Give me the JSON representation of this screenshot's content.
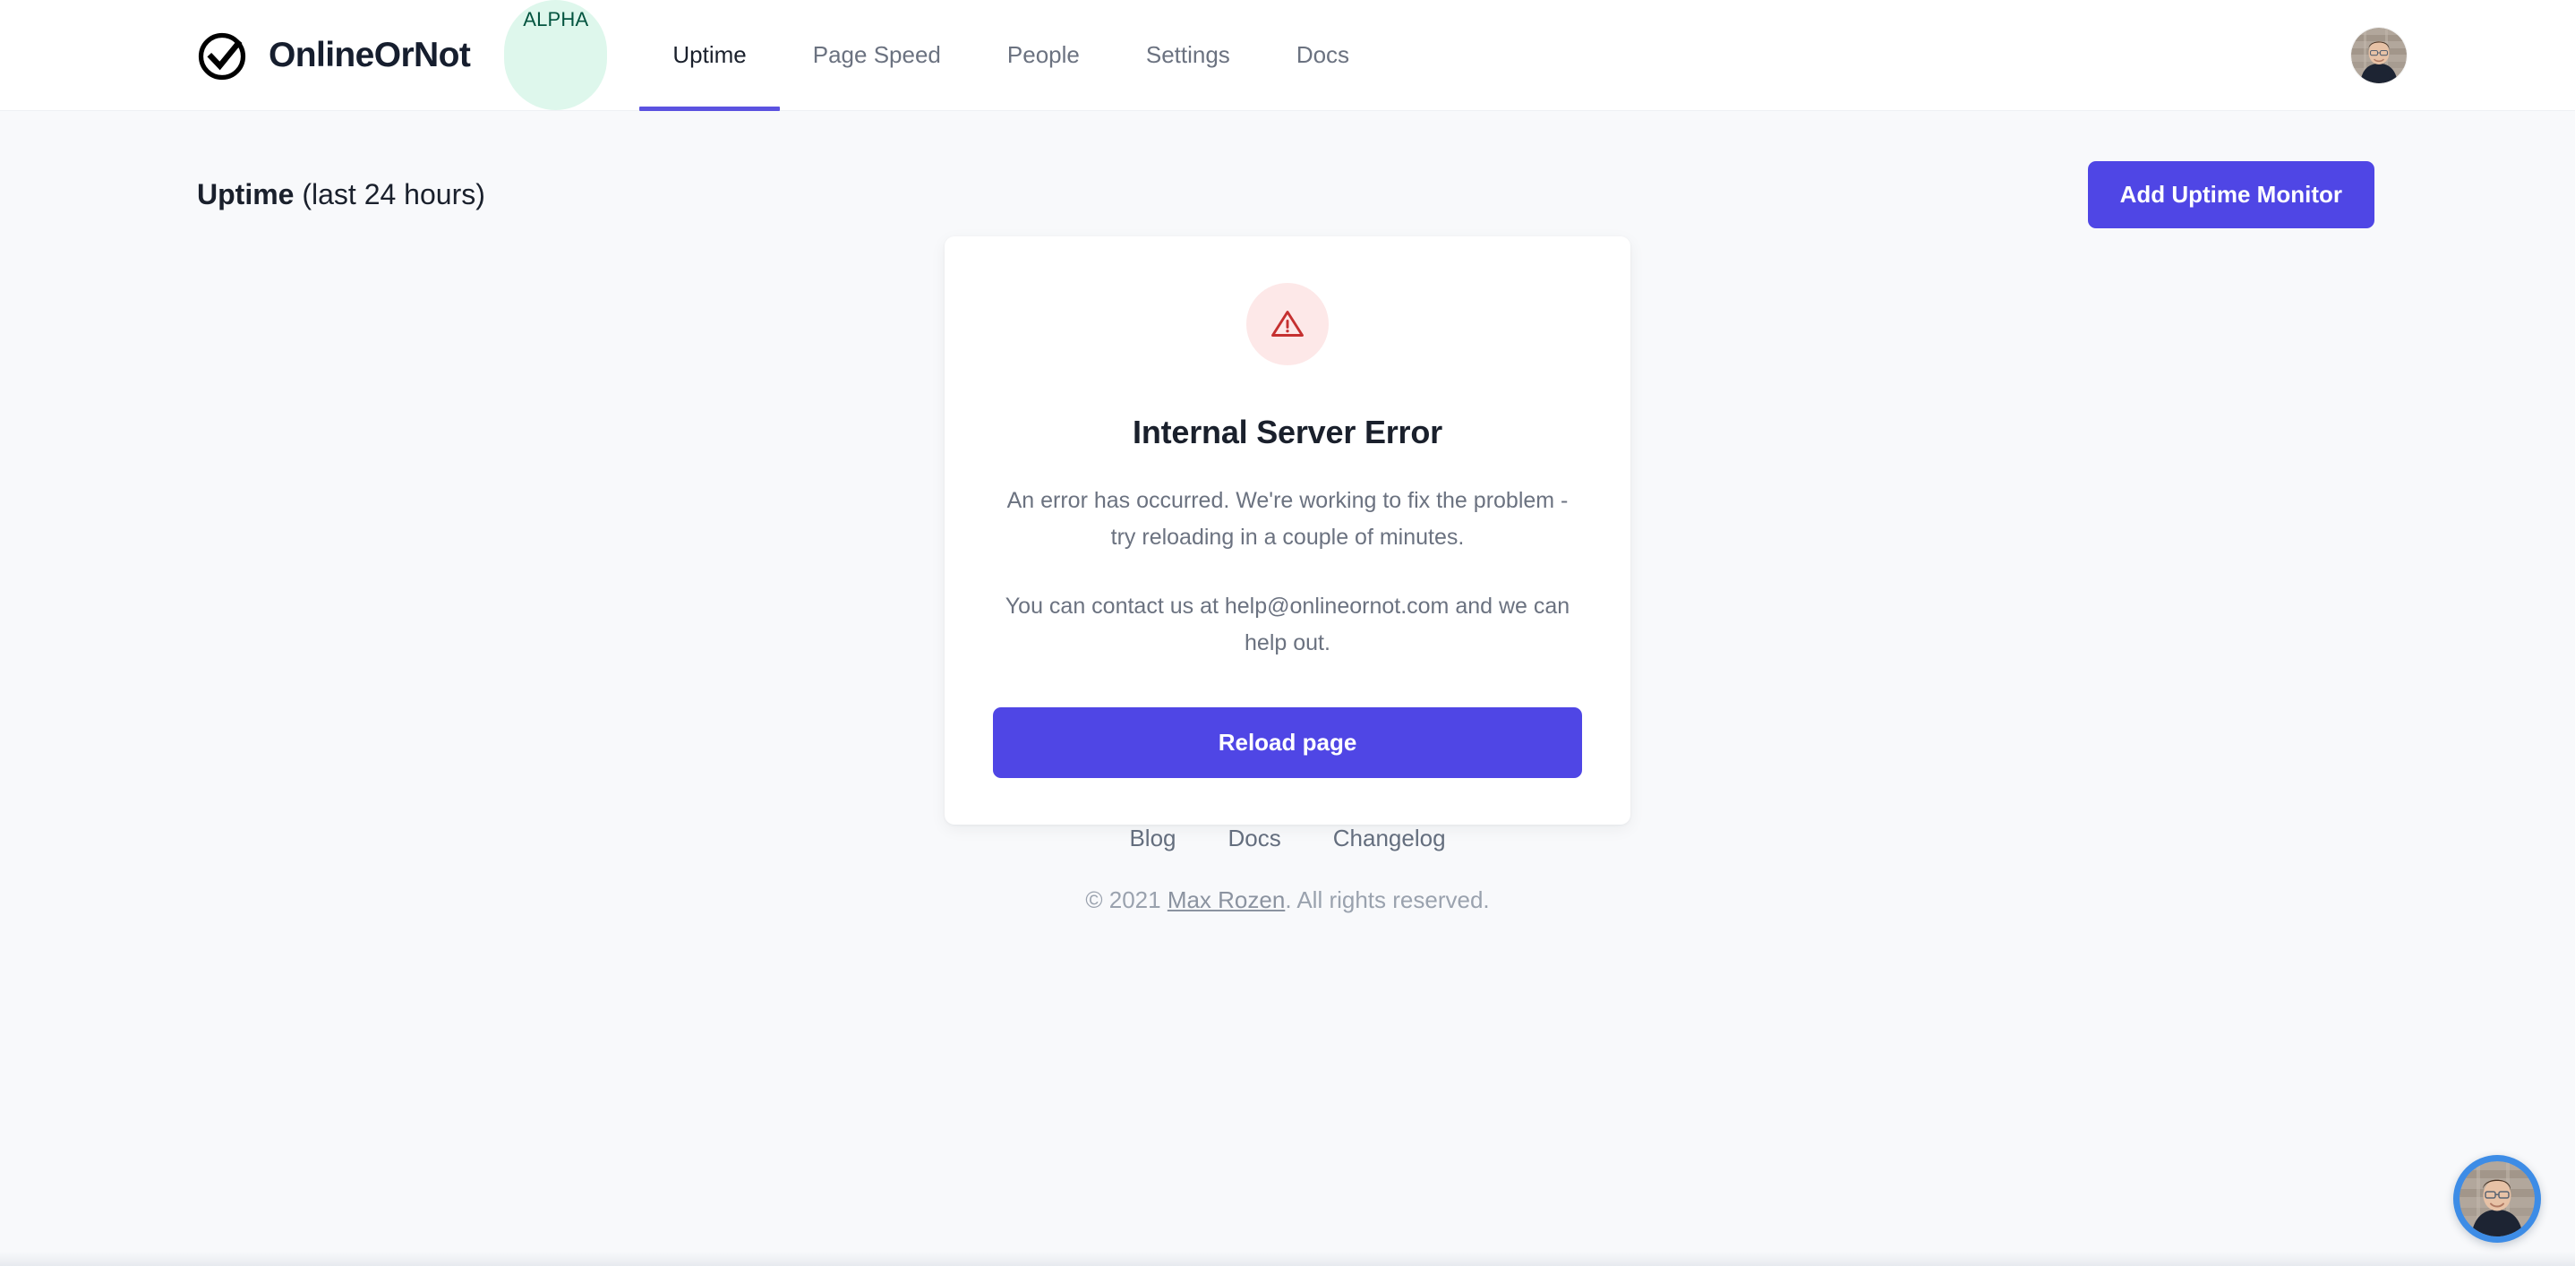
{
  "brand": {
    "logo_icon": "check-circle-icon",
    "name": "OnlineOrNot",
    "badge": "ALPHA"
  },
  "nav": {
    "items": [
      {
        "label": "Uptime",
        "active": true
      },
      {
        "label": "Page Speed",
        "active": false
      },
      {
        "label": "People",
        "active": false
      },
      {
        "label": "Settings",
        "active": false
      },
      {
        "label": "Docs",
        "active": false
      }
    ],
    "active_underline_color": "#5b52e0"
  },
  "account": {
    "avatar_icon": "avatar",
    "avatar_alt": "User profile photo"
  },
  "page_head": {
    "title_strong": "Uptime",
    "title_sub": "(last 24 hours)",
    "add_monitor_label": "Add Uptime Monitor",
    "add_monitor_color": "#4f46e5"
  },
  "error_card": {
    "icon": "warning-triangle-icon",
    "icon_color": "#c53030",
    "icon_bg": "#fde8e8",
    "title": "Internal Server Error",
    "paragraph_1": "An error has occurred. We're working to fix the problem - try reloading in a couple of minutes.",
    "paragraph_2": "You can contact us at help@onlineornot.com and we can help out.",
    "support_email": "help@onlineornot.com",
    "reload_label": "Reload page",
    "reload_color": "#4f46e5"
  },
  "footer": {
    "links": [
      {
        "label": "Blog"
      },
      {
        "label": "Docs"
      },
      {
        "label": "Changelog"
      }
    ],
    "copyright_prefix": "© 2021 ",
    "copyright_link": "Max Rozen",
    "copyright_suffix": ". All rights reserved."
  },
  "chat_widget": {
    "icon": "chat-avatar-icon",
    "ring_color": "#3d8ce6"
  }
}
